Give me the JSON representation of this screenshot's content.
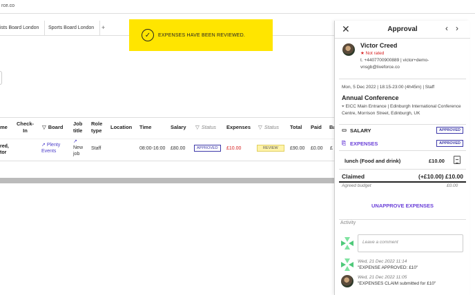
{
  "browser": {
    "url_fragment": "rce.co"
  },
  "tabs": [
    {
      "label": "ists Board London"
    },
    {
      "label": "Sports Board London"
    }
  ],
  "tab_add_label": "+",
  "toast": {
    "message": "EXPENSES HAVE BEEN REVIEWED."
  },
  "table": {
    "headers": {
      "name": "me",
      "checkin": "Check-\nIn",
      "board": "Board",
      "job_title": "Job\ntitle",
      "role_type": "Role\ntype",
      "location": "Location",
      "time": "Time",
      "salary": "Salary",
      "status1": "Status",
      "expenses": "Expenses",
      "status2": "Status",
      "total": "Total",
      "paid": "Paid",
      "ba": "Ba"
    },
    "row": {
      "name": "red,\ntor",
      "board": "Plenty\nEvents",
      "job_title": "New\njob",
      "role_type": "Staff",
      "time": "08:00-16:00",
      "salary": "£80.00",
      "status1": "APPROVED",
      "expenses": "£10.00",
      "status2": "REVIEW",
      "total": "£90.00",
      "paid": "£0.00",
      "ba": "£"
    }
  },
  "panel": {
    "title": "Approval",
    "person": {
      "name": "Victor Creed",
      "rating": "Not rated",
      "contact": "t. +4407700900889 | victor+demo-vnsgb@liveforce.co"
    },
    "shift": {
      "meta": "Mon, 5 Dec 2022 | 18:15-23:00 (4h45m) | Staff",
      "event": "Annual Conference",
      "address": "EICC Main Entrance | Edinburgh International Conference Centre, Morrison Street, Edinburgh, UK"
    },
    "salary_section": {
      "label": "SALARY",
      "status": "APPROVED"
    },
    "expenses_section": {
      "label": "EXPENSES",
      "status": "APPROVED"
    },
    "expense_item": {
      "label": "lunch (Food and drink)",
      "amount": "£10.00"
    },
    "claimed": {
      "label": "Claimed",
      "amount": "(+£10.00) £10.00"
    },
    "budget": {
      "label": "Agreed budget",
      "amount": "£0.00"
    },
    "unapprove_label": "UNAPPROVE EXPENSES",
    "activity_label": "Activity",
    "comment_placeholder": "Leave a comment",
    "activity": [
      {
        "time": "Wed, 21 Dec 2022 11:14",
        "text": "\"EXPENSE APPROVED: £10\""
      },
      {
        "time": "Wed, 21 Dec 2022 11:05",
        "text": "\"EXPENSES CLAIM submitted for £10\""
      }
    ]
  },
  "colors": {
    "toast_bg": "#ffe500",
    "accent_purple": "#6a3fd8",
    "approved_badge": "#3b37a8",
    "warning_red": "#d62020"
  }
}
